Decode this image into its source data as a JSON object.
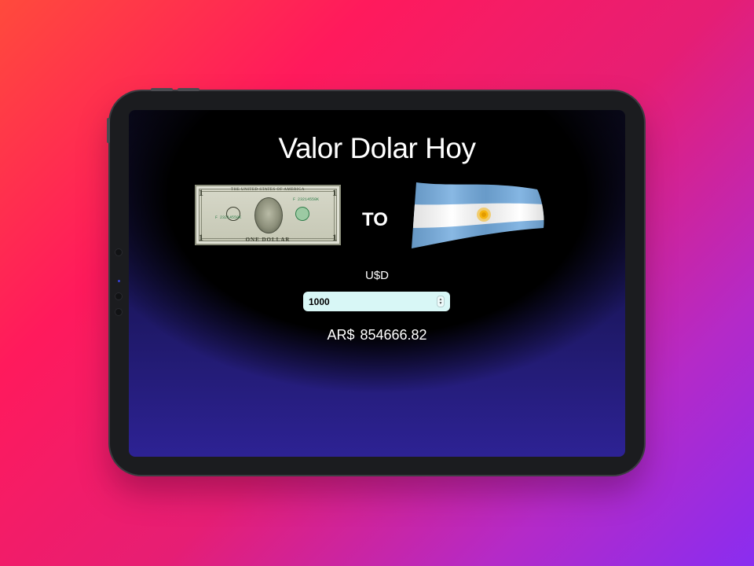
{
  "page": {
    "title": "Valor Dolar Hoy",
    "to_label": "TO"
  },
  "images": {
    "left": "us-dollar-bill",
    "right": "argentina-flag"
  },
  "converter": {
    "input_currency": "U$D",
    "input_value": "1000",
    "result_currency": "AR$",
    "result_value": "854666.82"
  },
  "colors": {
    "background_start": "#ff4a3c",
    "background_end": "#8a2df0",
    "screen_bottom": "#2d2294",
    "input_bg": "#d8f7f6",
    "flag_blue": "#74acdf",
    "sun": "#f6b40e"
  }
}
